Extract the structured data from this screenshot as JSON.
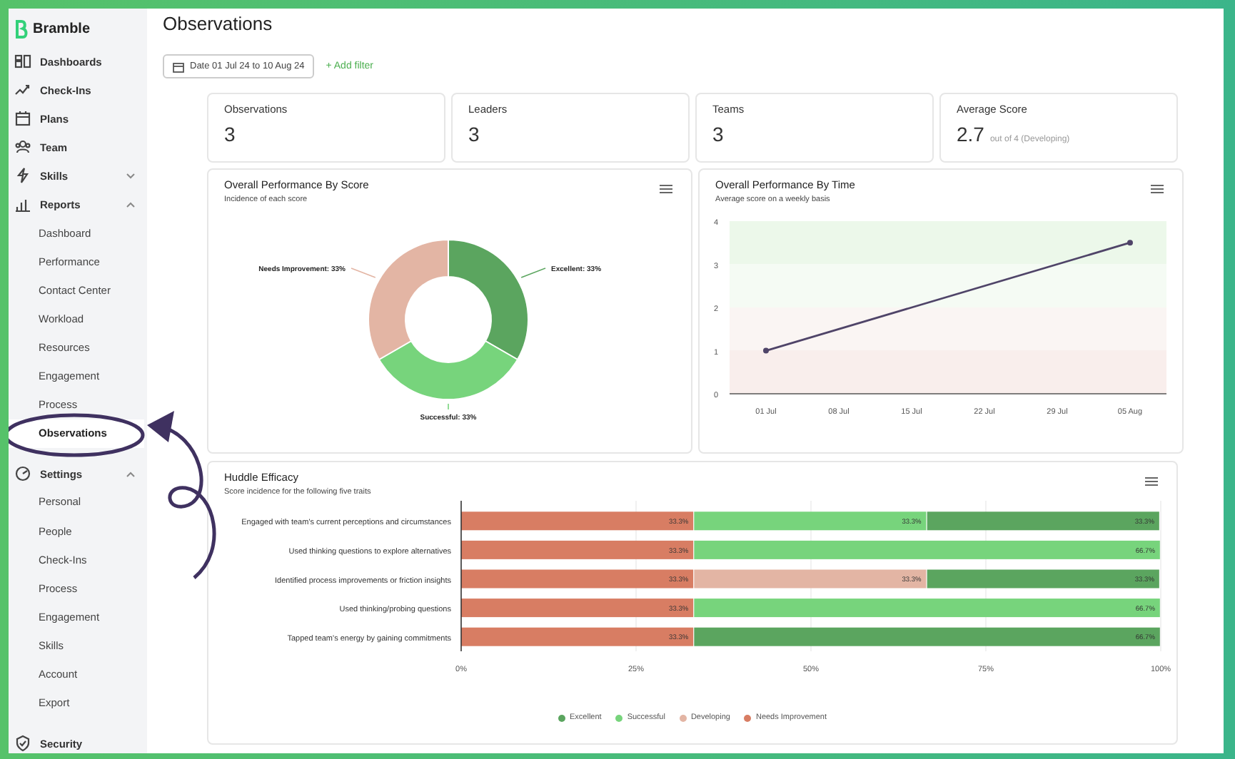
{
  "app": {
    "name": "Bramble"
  },
  "sidebar": {
    "items": [
      {
        "label": "Dashboards",
        "selected": false
      },
      {
        "label": "Check-Ins",
        "selected": false
      },
      {
        "label": "Plans",
        "selected": false
      },
      {
        "label": "Team",
        "selected": false
      },
      {
        "label": "Skills",
        "expanded": false,
        "selected": false
      },
      {
        "label": "Reports",
        "expanded": true,
        "selected": false,
        "children": [
          {
            "label": "Dashboard",
            "selected": false
          },
          {
            "label": "Performance",
            "selected": false
          },
          {
            "label": "Contact Center",
            "selected": false
          },
          {
            "label": "Workload",
            "selected": false
          },
          {
            "label": "Resources",
            "selected": false
          },
          {
            "label": "Engagement",
            "selected": false
          },
          {
            "label": "Process",
            "selected": false
          },
          {
            "label": "Observations",
            "selected": true
          }
        ]
      },
      {
        "label": "Settings",
        "expanded": true,
        "selected": false,
        "children": [
          {
            "label": "Personal",
            "selected": false
          },
          {
            "label": "People",
            "selected": false
          },
          {
            "label": "Check-Ins",
            "selected": false
          },
          {
            "label": "Process",
            "selected": false
          },
          {
            "label": "Engagement",
            "selected": false
          },
          {
            "label": "Skills",
            "selected": false
          },
          {
            "label": "Account",
            "selected": false
          },
          {
            "label": "Export",
            "selected": false
          }
        ]
      },
      {
        "label": "Security",
        "selected": false
      }
    ]
  },
  "page": {
    "title": "Observations"
  },
  "filters": {
    "date": "Date 01 Jul 24 to 10 Aug 24",
    "add_filter": "+ Add filter"
  },
  "stats": [
    {
      "label": "Observations",
      "value": "3"
    },
    {
      "label": "Leaders",
      "value": "3"
    },
    {
      "label": "Teams",
      "value": "3"
    },
    {
      "label": "Average Score",
      "value": "2.7",
      "note": "out of 4 (Developing)"
    }
  ],
  "score_chart": {
    "title": "Overall Performance By Score",
    "subtitle": "Incidence of each score",
    "chart_data": {
      "type": "donut",
      "values": [
        33,
        33,
        33
      ],
      "colors": [
        "#5ba55f",
        "#77d47c",
        "#e3b5a4"
      ],
      "value_labels": [
        "Excellent: 33%",
        "Successful: 33%",
        "Needs Improvement: 33%"
      ]
    }
  },
  "time_chart": {
    "title": "Overall Performance By Time",
    "subtitle": "Average score on a weekly basis",
    "chart_data": {
      "type": "line",
      "categories": [
        "01 Jul",
        "08 Jul",
        "15 Jul",
        "22 Jul",
        "29 Jul",
        "05 Aug"
      ],
      "ylim": [
        0,
        4
      ],
      "yticks": [
        0,
        1,
        2,
        3,
        4
      ],
      "series": [
        {
          "color": "#4f4468",
          "marker": true,
          "values": [
            1,
            null,
            null,
            null,
            null,
            3.5
          ]
        }
      ]
    }
  },
  "huddle_chart": {
    "title": "Huddle Efficacy",
    "subtitle": "Score incidence for the following five traits",
    "chart_data": {
      "type": "bar",
      "orientation": "horizontal",
      "stacked": true,
      "grid": true,
      "legend": true,
      "categories": [
        "Engaged with team's current perceptions and circumstances",
        "Used thinking questions to explore alternatives",
        "Identified process improvements or friction insights",
        "Used thinking/probing questions",
        "Tapped team's energy by gaining commitments"
      ],
      "xlim": [
        0,
        100
      ],
      "xticks": [
        {
          "value": 0,
          "label": "0%"
        },
        {
          "value": 25,
          "label": "25%"
        },
        {
          "value": 50,
          "label": "50%"
        },
        {
          "value": 75,
          "label": "75%"
        },
        {
          "value": 100,
          "label": "100%"
        }
      ],
      "series": [
        {
          "name": "Excellent",
          "color": "#5ba55f",
          "values": [
            33.3,
            null,
            33.3,
            null,
            66.7
          ],
          "value_labels": [
            "33.3%",
            null,
            "33.3%",
            null,
            "66.7%"
          ]
        },
        {
          "name": "Successful",
          "color": "#77d47c",
          "values": [
            33.3,
            66.7,
            null,
            66.7,
            null
          ],
          "value_labels": [
            "33.3%",
            "66.7%",
            null,
            "66.7%",
            null
          ]
        },
        {
          "name": "Developing",
          "color": "#e3b5a4",
          "values": [
            null,
            null,
            33.3,
            null,
            null
          ],
          "value_labels": [
            null,
            null,
            "33.3%",
            null,
            null
          ]
        },
        {
          "name": "Needs Improvement",
          "color": "#d87d63",
          "values": [
            33.3,
            33.3,
            33.3,
            33.3,
            33.3
          ],
          "value_labels": [
            "33.3%",
            "33.3%",
            "33.3%",
            "33.3%",
            "33.3%"
          ]
        }
      ]
    }
  }
}
